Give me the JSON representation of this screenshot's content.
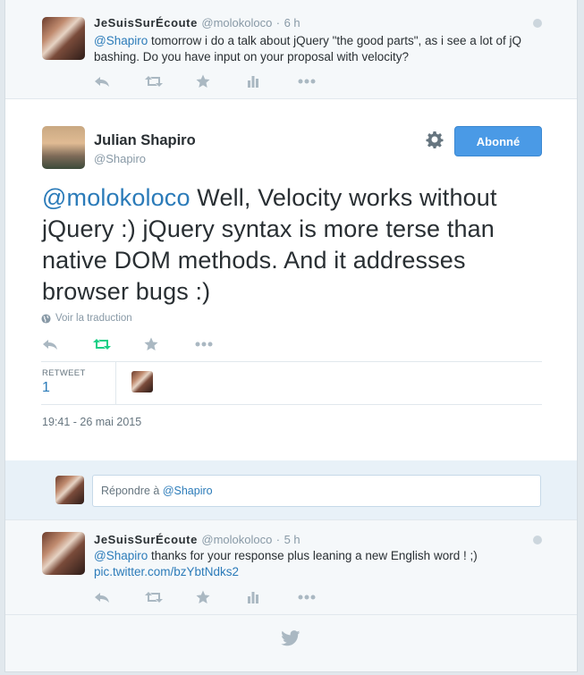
{
  "tweet1": {
    "display_name": "JeSuisSurÉcoute",
    "handle": "@molokoloco",
    "separator": "·",
    "time": "6 h",
    "mention": "@Shapiro",
    "text": " tomorrow i do a talk about jQuery \"the good parts\", as i see a lot of jQ bashing. Do you have input on your proposal with velocity?"
  },
  "main": {
    "display_name": "Julian Shapiro",
    "handle": "@Shapiro",
    "follow_label": "Abonné",
    "mention": "@molokoloco",
    "text": " Well, Velocity works without jQuery :) jQuery syntax is more terse than native DOM methods. And it addresses browser bugs :)",
    "translate_label": "Voir la traduction",
    "retweet_label": "RETWEET",
    "retweet_count": "1",
    "timestamp": "19:41 - 26 mai 2015",
    "retweet_color": "#19cf86"
  },
  "reply": {
    "prefix": "Répondre à ",
    "mention": "@Shapiro"
  },
  "tweet2": {
    "display_name": "JeSuisSurÉcoute",
    "handle": "@molokoloco",
    "separator": "·",
    "time": "5 h",
    "mention": "@Shapiro",
    "text": " thanks for your response plus leaning a new English word ! ;)",
    "link": "pic.twitter.com/bzYbtNdks2"
  },
  "icons": [
    "reply-icon",
    "retweet-icon",
    "favorite-icon",
    "stats-icon",
    "more-icon",
    "gear-icon",
    "globe-icon",
    "twitter-bird-icon"
  ]
}
